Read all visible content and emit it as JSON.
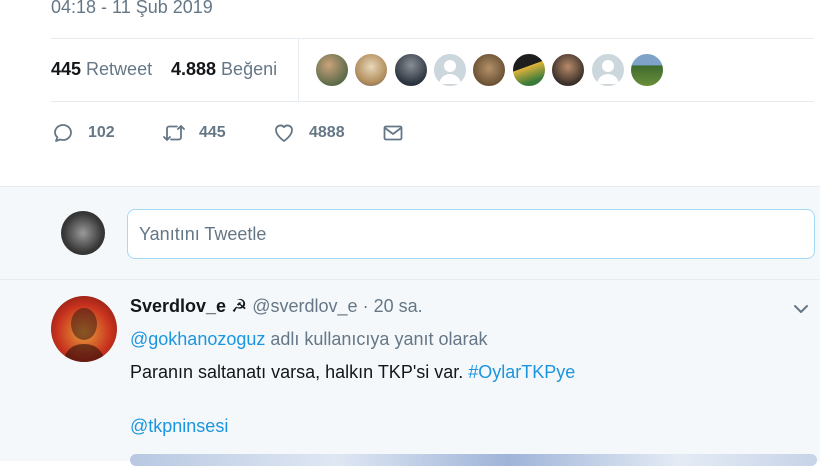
{
  "tweet": {
    "timestamp": "04:18 - 11 Şub 2019",
    "stats": {
      "retweet_count": "445",
      "retweet_label": "Retweet",
      "like_count": "4.888",
      "like_label": "Beğeni"
    },
    "actions": {
      "reply_count": "102",
      "retweet_count": "445",
      "like_count": "4888"
    }
  },
  "composer": {
    "placeholder": "Yanıtını Tweetle"
  },
  "reply": {
    "name": "Sverdlov_e",
    "emoji": "☭",
    "handle": "@sverdlov_e",
    "time": "· 20 sa.",
    "replying_to_user": "@gokhanozoguz",
    "replying_to_suffix": " adlı kullanıcıya yanıt olarak",
    "text": "Paranın saltanatı varsa, halkın TKP'si var. ",
    "hashtag": "#OylarTKPye",
    "mention": "@tkpninsesi"
  },
  "colors": {
    "link": "#1b95e0",
    "muted": "#657786",
    "background_light": "#f5f8fa",
    "input_border": "#a4d9f9"
  },
  "icons": {
    "reply": "reply-icon",
    "retweet": "retweet-icon",
    "like": "heart-icon",
    "dm": "envelope-icon",
    "more": "chevron-down-icon"
  }
}
